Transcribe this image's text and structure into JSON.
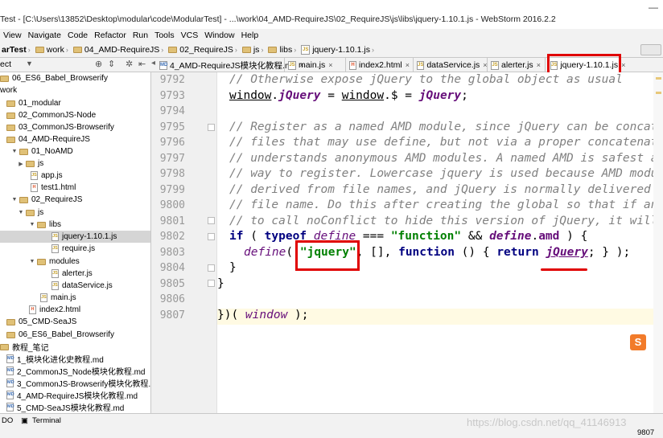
{
  "window": {
    "title": "Test - [C:\\Users\\13852\\Desktop\\modular\\code\\ModularTest] - ...\\work\\04_AMD-RequireJS\\02_RequireJS\\js\\libs\\jquery-1.10.1.js - WebStorm 2016.2.2",
    "minimize": "—"
  },
  "menu": [
    "View",
    "Navigate",
    "Code",
    "Refactor",
    "Run",
    "Tools",
    "VCS",
    "Window",
    "Help"
  ],
  "breadcrumb": [
    "arTest",
    "work",
    "04_AMD-RequireJS",
    "02_RequireJS",
    "js",
    "libs",
    "jquery-1.10.1.js"
  ],
  "project_panel": {
    "label": "ect",
    "dropdown": "▼"
  },
  "tabs": [
    {
      "label": "4_AMD-RequireJS模块化教程.md",
      "type": "md"
    },
    {
      "label": "main.js",
      "type": "js"
    },
    {
      "label": "index2.html",
      "type": "html"
    },
    {
      "label": "dataService.js",
      "type": "js"
    },
    {
      "label": "alerter.js",
      "type": "js"
    },
    {
      "label": "jquery-1.10.1.js",
      "type": "js"
    }
  ],
  "tree": [
    {
      "label": "06_ES6_Babel_Browserify",
      "kind": "folder"
    },
    {
      "label": "work",
      "kind": "folder"
    },
    {
      "label": "01_modular",
      "kind": "folder"
    },
    {
      "label": "02_CommonJS-Node",
      "kind": "folder"
    },
    {
      "label": "03_CommonJS-Browserify",
      "kind": "folder"
    },
    {
      "label": "04_AMD-RequireJS",
      "kind": "folder"
    },
    {
      "label": "01_NoAMD",
      "kind": "folder"
    },
    {
      "label": "js",
      "kind": "folder"
    },
    {
      "label": "app.js",
      "kind": "js"
    },
    {
      "label": "test1.html",
      "kind": "html"
    },
    {
      "label": "02_RequireJS",
      "kind": "folder"
    },
    {
      "label": "js",
      "kind": "folder"
    },
    {
      "label": "libs",
      "kind": "folder"
    },
    {
      "label": "jquery-1.10.1.js",
      "kind": "js"
    },
    {
      "label": "require.js",
      "kind": "js"
    },
    {
      "label": "modules",
      "kind": "folder"
    },
    {
      "label": "alerter.js",
      "kind": "js"
    },
    {
      "label": "dataService.js",
      "kind": "js"
    },
    {
      "label": "main.js",
      "kind": "js"
    },
    {
      "label": "index2.html",
      "kind": "html"
    },
    {
      "label": "05_CMD-SeaJS",
      "kind": "folder"
    },
    {
      "label": "06_ES6_Babel_Browserify",
      "kind": "folder"
    },
    {
      "label": "教程_笔记",
      "kind": "folder"
    },
    {
      "label": "1_模块化进化史教程.md",
      "kind": "md"
    },
    {
      "label": "2_CommonJS_Node模块化教程.md",
      "kind": "md"
    },
    {
      "label": "3_CommonJS-Browserify模块化教程.md",
      "kind": "md"
    },
    {
      "label": "4_AMD-RequireJS模块化教程.md",
      "kind": "md"
    },
    {
      "label": "5_CMD-SeaJS模块化教程.md",
      "kind": "md"
    }
  ],
  "line_numbers": [
    "9792",
    "9793",
    "9794",
    "9795",
    "9796",
    "9797",
    "9798",
    "9799",
    "9800",
    "9801",
    "9802",
    "9803",
    "9804",
    "9805",
    "9806",
    "9807"
  ],
  "code": {
    "l9792": "// Otherwise expose jQuery to the global object as usual",
    "l9793_a": "window",
    "l9793_b": ".",
    "l9793_c": "jQuery",
    "l9793_d": " = ",
    "l9793_e": "window",
    "l9793_f": ".$ = ",
    "l9793_g": "jQuery",
    "l9793_h": ";",
    "l9795": "// Register as a named AMD module, since jQuery can be concat",
    "l9796": "// files that may use define, but not via a proper concatenat",
    "l9797": "// understands anonymous AMD modules. A named AMD is safest a",
    "l9798": "// way to register. Lowercase jquery is used because AMD modu",
    "l9799": "// derived from file names, and jQuery is normally delivered",
    "l9800": "// file name. Do this after creating the global so that if an",
    "l9801": "// to call noConflict to hide this version of jQuery, it will",
    "l9802_if": "if",
    "l9802_p1": " ( ",
    "l9802_typeof": "typeof",
    "l9802_define": " define",
    "l9802_eq": " === ",
    "l9802_str": "\"function\"",
    "l9802_and": " && ",
    "l9802_define2": "define",
    "l9802_dot": ".",
    "l9802_amd": "amd",
    "l9802_end": " ) {",
    "l9803_define": "define",
    "l9803_p": "( ",
    "l9803_str": "\"jquery\"",
    "l9803_mid": ", [], ",
    "l9803_function": "function",
    "l9803_mid2": " () { ",
    "l9803_return": "return",
    "l9803_sp": " ",
    "l9803_jq": "jQuery",
    "l9803_end": "; } );",
    "l9804": "}",
    "l9805": "}",
    "l9807_a": "})( ",
    "l9807_b": "window",
    "l9807_c": " );"
  },
  "status": {
    "todo": "DO",
    "terminal": "Terminal",
    "position": "9807"
  },
  "watermark": "https://blog.csdn.net/qq_41146913",
  "colors": {
    "annotation": "#e00000",
    "current_line": "#fffae3",
    "keyword": "#000080",
    "string": "#008000",
    "comment": "#808080"
  }
}
